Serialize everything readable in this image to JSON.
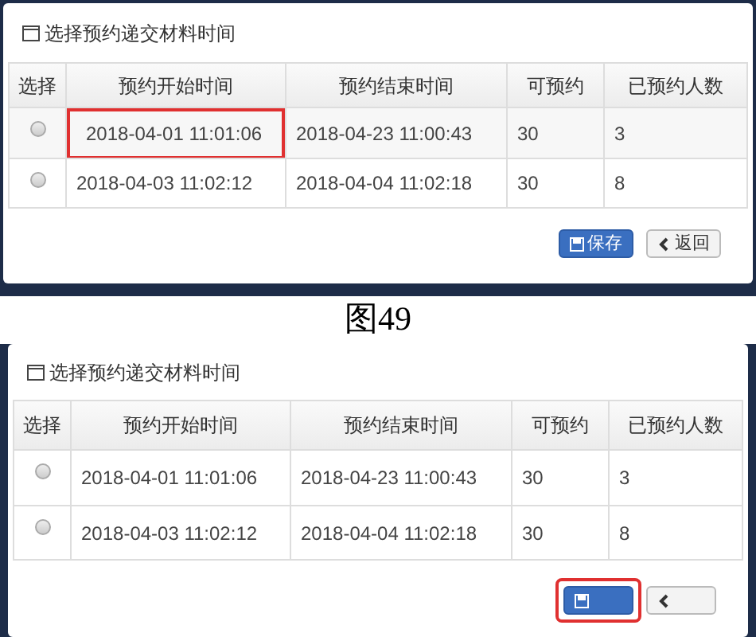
{
  "panels": [
    {
      "title": "选择预约递交材料时间",
      "columns": [
        "选择",
        "预约开始时间",
        "预约结束时间",
        "可预约",
        "已预约人数"
      ],
      "rows": [
        {
          "selected": false,
          "start_highlighted": true,
          "cells": [
            "",
            "2018-04-01 11:01:06",
            "2018-04-23 11:00:43",
            "30",
            "3"
          ]
        },
        {
          "selected": false,
          "start_highlighted": false,
          "cells": [
            "",
            "2018-04-03 11:02:12",
            "2018-04-04 11:02:18",
            "30",
            "8"
          ]
        }
      ],
      "buttons": [
        {
          "kind": "primary",
          "label": "保存"
        },
        {
          "kind": "default",
          "label": "返回"
        }
      ]
    },
    {
      "title": "选择预约递交材料时间",
      "columns": [
        "选择",
        "预约开始时间",
        "预约结束时间",
        "可预约",
        "已预约人数"
      ],
      "rows": [
        {
          "selected": false,
          "start_highlighted": false,
          "cells": [
            "",
            "2018-04-01 11:01:06",
            "2018-04-23 11:00:43",
            "30",
            "3"
          ]
        },
        {
          "selected": false,
          "start_highlighted": false,
          "cells": [
            "",
            "2018-04-03 11:02:12",
            "2018-04-04 11:02:18",
            "30",
            "8"
          ]
        }
      ],
      "buttons": [
        {
          "kind": "primary",
          "highlighted": true
        },
        {
          "kind": "default"
        }
      ]
    }
  ],
  "captions": [
    "图49"
  ]
}
